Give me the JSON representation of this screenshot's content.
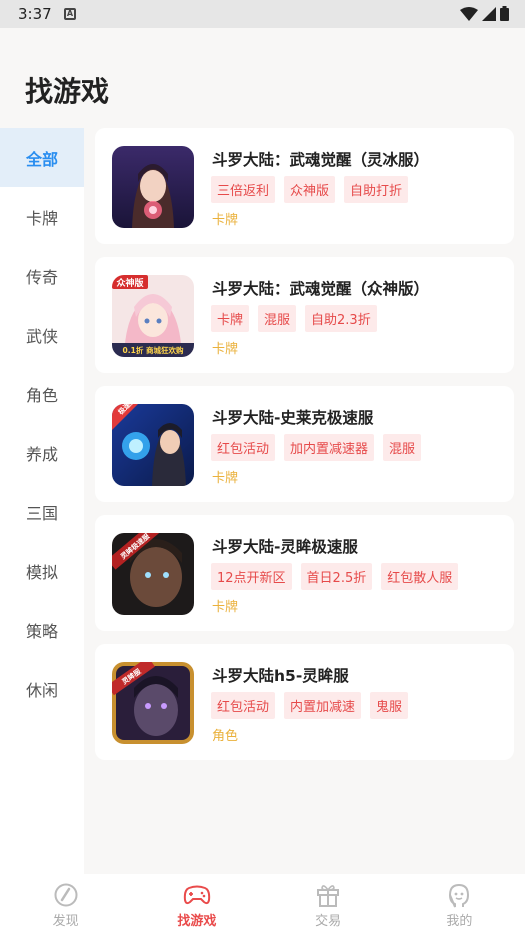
{
  "status_bar": {
    "time": "3:37",
    "notif_letter": "A"
  },
  "page": {
    "title": "找游戏"
  },
  "sidebar": {
    "items": [
      {
        "label": "全部"
      },
      {
        "label": "卡牌"
      },
      {
        "label": "传奇"
      },
      {
        "label": "武侠"
      },
      {
        "label": "角色"
      },
      {
        "label": "养成"
      },
      {
        "label": "三国"
      },
      {
        "label": "模拟"
      },
      {
        "label": "策略"
      },
      {
        "label": "休闲"
      }
    ],
    "active_index": 0
  },
  "games": [
    {
      "title": "斗罗大陆：武魂觉醒（灵冰服）",
      "tags": [
        "三倍返利",
        "众神版",
        "自助打折"
      ],
      "category": "卡牌"
    },
    {
      "title": "斗罗大陆：武魂觉醒（众神版）",
      "tags": [
        "卡牌",
        "混服",
        "自助2.3折"
      ],
      "category": "卡牌",
      "badge_text": "众神版",
      "banner_text": "0.1折 商城狂欢购"
    },
    {
      "title": "斗罗大陆-史莱克极速服",
      "tags": [
        "红包活动",
        "加内置减速器",
        "混服"
      ],
      "category": "卡牌",
      "badge_text": "极速服"
    },
    {
      "title": "斗罗大陆-灵眸极速服",
      "tags": [
        "12点开新区",
        "首日2.5折",
        "红包散人服"
      ],
      "category": "卡牌",
      "badge_text": "灵眸极速服"
    },
    {
      "title": "斗罗大陆h5-灵眸服",
      "tags": [
        "红包活动",
        "内置加减速",
        "鬼服"
      ],
      "category": "角色",
      "badge_text": "灵眸服"
    }
  ],
  "bottom_nav": {
    "items": [
      {
        "label": "发现",
        "icon": "compass-icon"
      },
      {
        "label": "找游戏",
        "icon": "gamepad-icon"
      },
      {
        "label": "交易",
        "icon": "gift-icon"
      },
      {
        "label": "我的",
        "icon": "profile-icon"
      }
    ],
    "active_index": 1
  },
  "colors": {
    "accent_blue": "#2a8ef0",
    "accent_red": "#e94b4b",
    "tag_bg": "#fdeaea",
    "category": "#eab13c"
  }
}
